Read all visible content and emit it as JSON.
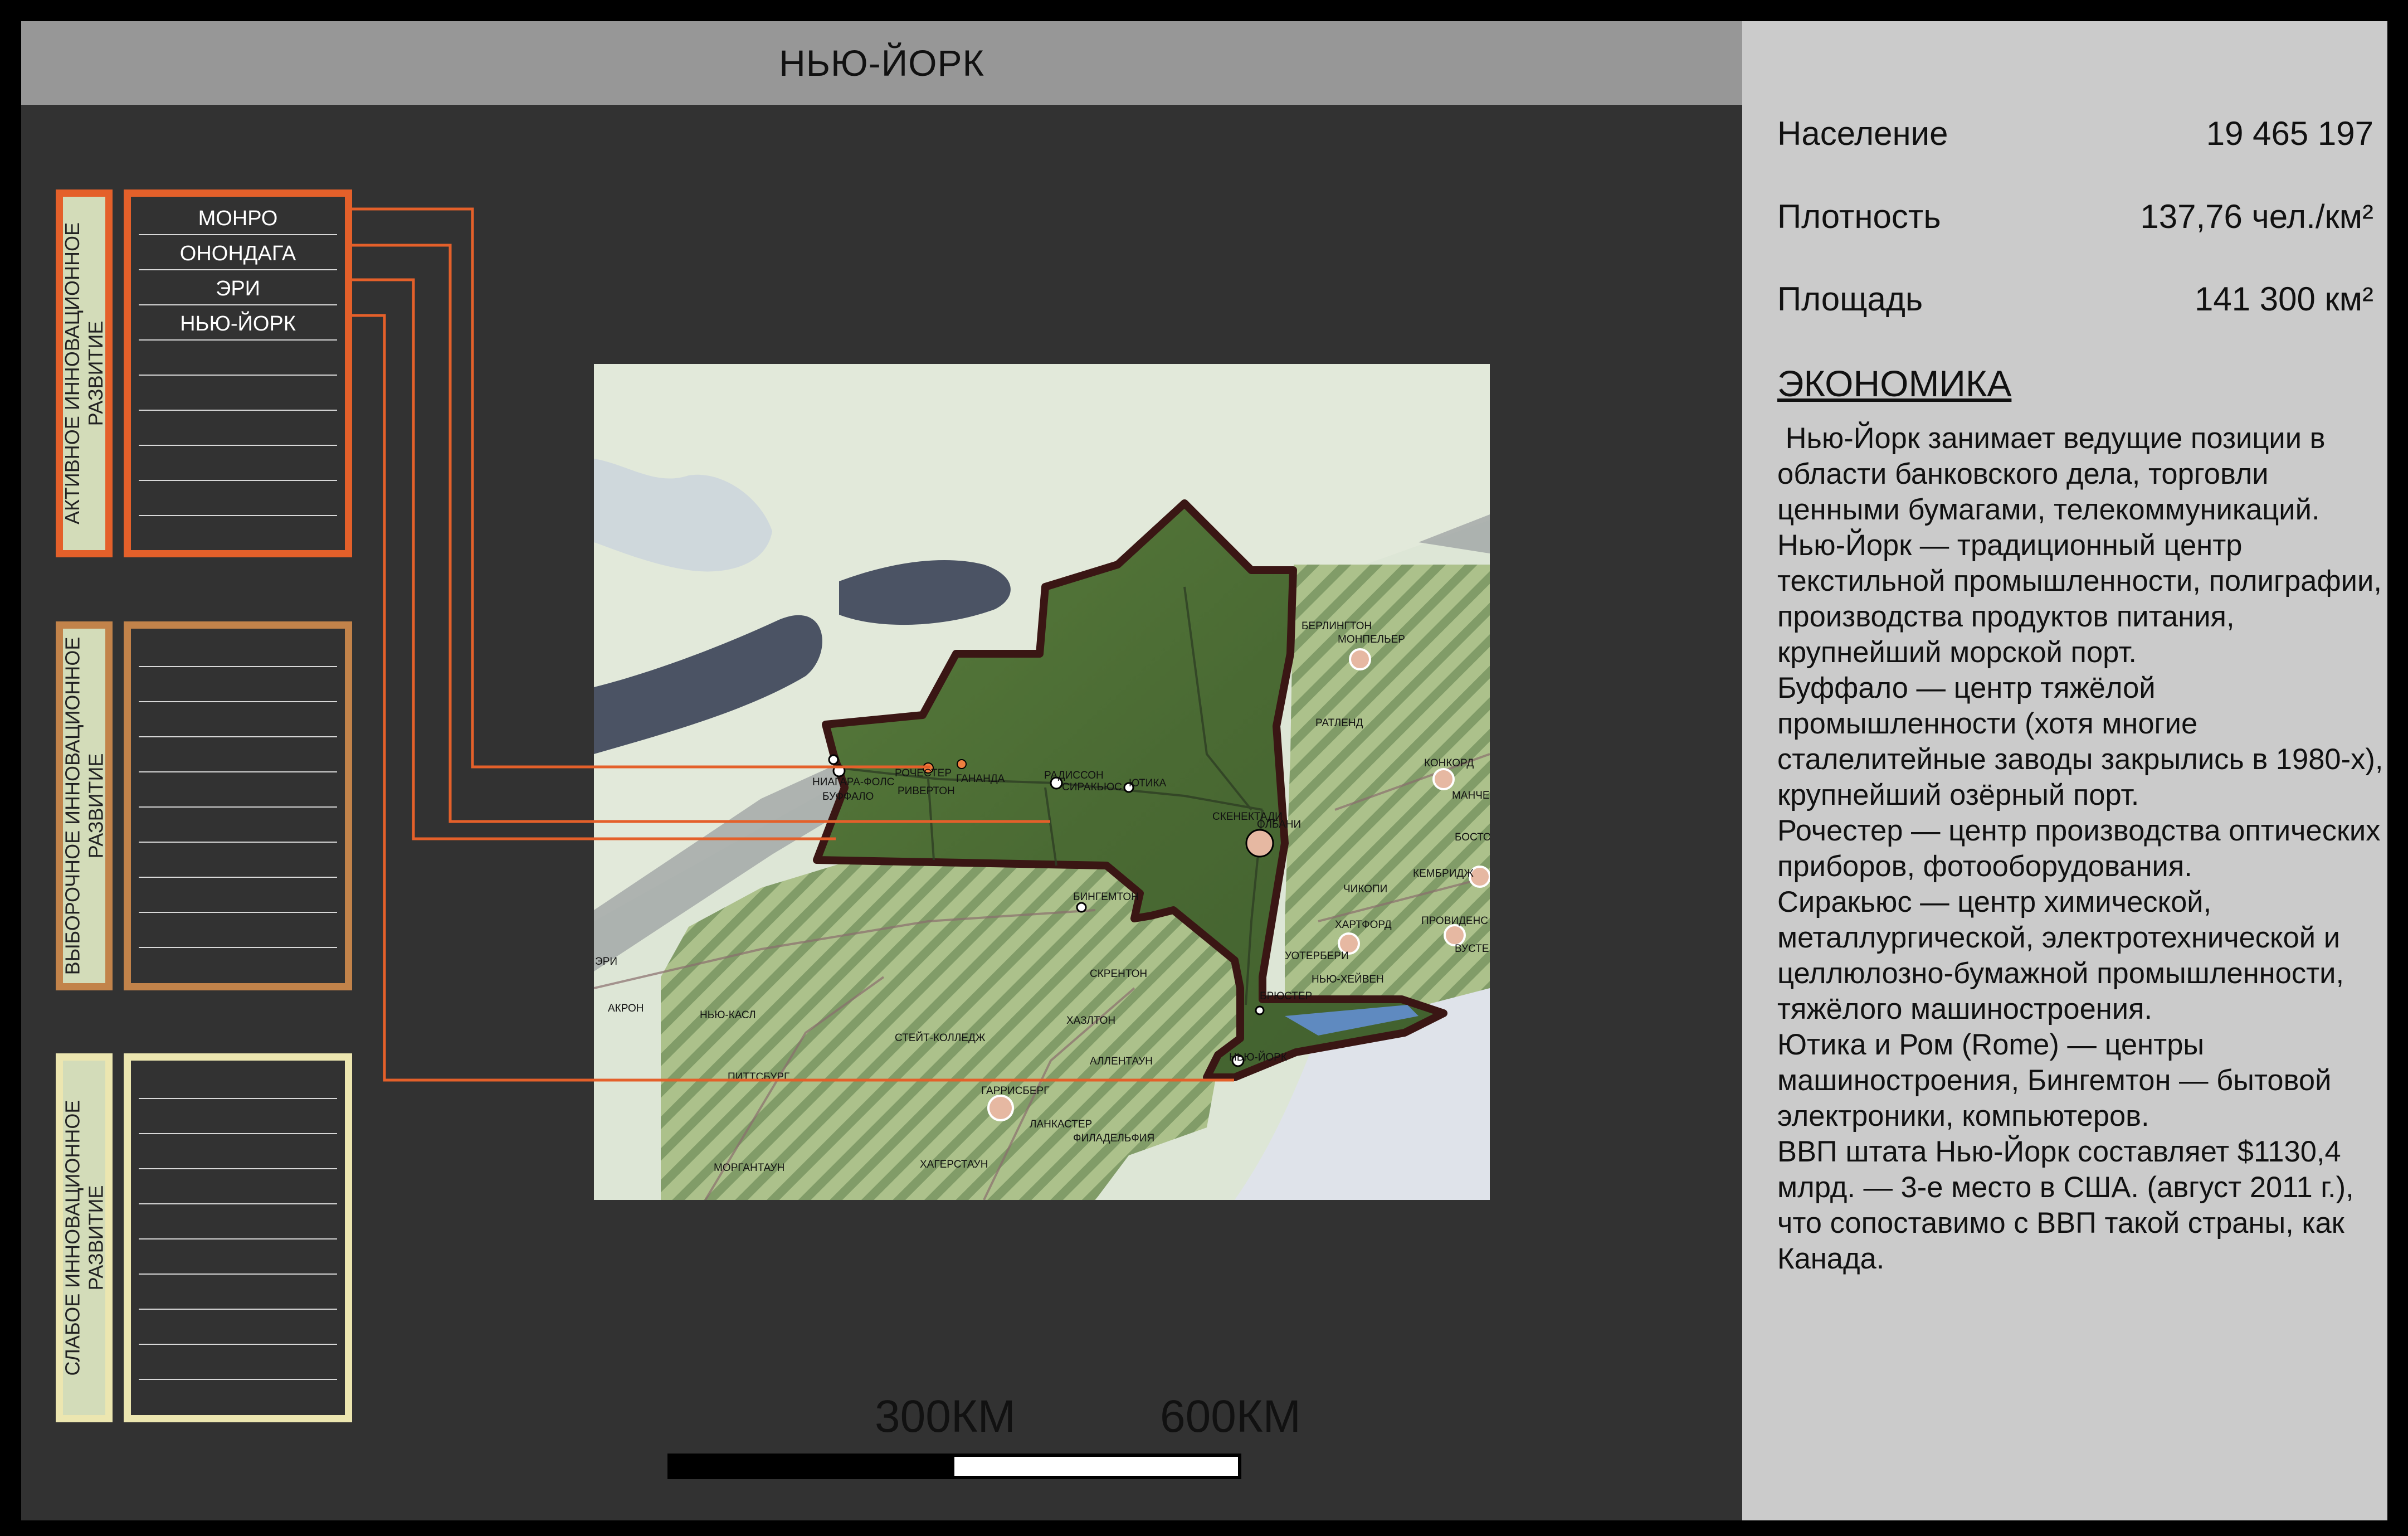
{
  "title": "НЬЮ-ЙОРК",
  "stats": [
    {
      "label": "Население",
      "value": "19 465 197"
    },
    {
      "label": "Плотность",
      "value": "137,76 чел./км²"
    },
    {
      "label": "Площадь",
      "value": "141 300 км²"
    }
  ],
  "economy": {
    "heading": "ЭКОНОМИКА",
    "paragraphs": [
      " Нью-Йорк занимает ведущие позиции в области банковского дела, торговли ценными бумагами, телекоммуникаций.",
      "Нью-Йорк — традиционный центр текстильной промышленности, полиграфии, производства продуктов питания, крупнейший морской порт.",
      "Буффало — центр тяжёлой промышленности (хотя многие сталелитейные заводы закрылись в 1980-х), крупнейший озёрный порт.",
      "Рочестер — центр производства оптических приборов, фотооборудования.",
      "Сиракьюс — центр химической, металлургической, электротехнической и целлюлозно-бумажной промышленности, тяжёлого машиностроения.",
      "Ютика и Ром (Rome) — центры машиностроения, Бингемтон — бытовой электроники, компьютеров.",
      "ВВП штата Нью-Йорк составляет $1130,4 млрд. — 3-е место в США. (август 2011 г.), что сопоставимо с ВВП такой страны, как Канада."
    ]
  },
  "categories": [
    {
      "label": "АКТИВНОЕ ИННОВАЦИОННОЕ\nРАЗВИТИЕ",
      "color": "#e4602a",
      "items": [
        "МОНРО",
        "ОНОНДАГА",
        "ЭРИ",
        "НЬЮ-ЙОРК"
      ]
    },
    {
      "label": "ВЫБОРОЧНОЕ ИННОВАЦИОННОЕ\nРАЗВИТИЕ",
      "color": "#c2834a",
      "items": []
    },
    {
      "label": "СЛАБОЕ ИННОВАЦИОННОЕ\nРАЗВИТИЕ",
      "color": "#ece6b0",
      "items": []
    }
  ],
  "map": {
    "cities_ny": [
      "НИАГАРА-ФОЛС",
      "РОЧЕСТЕР",
      "ГАНАНДА",
      "РИВЕРТОН",
      "БУФФАЛО",
      "РАДИССОН",
      "СИРАКЬЮС",
      "ЮТИКА",
      "СКЕНЕКТАДИ",
      "ОЛБАНИ",
      "БИНГЕМТОН",
      "БРЮСТЕР",
      "НЬЮ-ЙОРК"
    ],
    "cities_other": [
      "БЕРЛИНГТОН",
      "МОНПЕЛЬЕР",
      "РАТЛЕНД",
      "КОНКОРД",
      "МАНЧЕСТЕР",
      "БОСТОН",
      "КЕМБРИДЖ",
      "ЧИКОПИ",
      "ХАРТФОРД",
      "ПРОВИДЕНС",
      "ВУСТЕР",
      "УОТЕРБЕРИ",
      "НЬЮ-ХЕЙВЕН",
      "ЭРИ",
      "АКРОН",
      "НЬЮ-КАСЛ",
      "ПИТТСБУРГ",
      "СТЕЙТ-КОЛЛЕДЖ",
      "СКРЕНТОН",
      "ХАЗЛТОН",
      "АЛЛЕНТАУН",
      "ГАРРИСБЕРГ",
      "ЛАНКАСТЕР",
      "ФИЛАДЕЛЬФИЯ",
      "МОРГАНТАУН",
      "ХАГЕРСТАУН"
    ]
  },
  "scale": {
    "label_1": "300КМ",
    "label_2": "600КМ"
  },
  "colors": {
    "panel_dark": "#323232",
    "title_bar": "#979797",
    "info_panel": "#cbcbcb",
    "leader_line": "#e4602a",
    "state_fill": "#4c6b35",
    "state_border": "#3a1614"
  }
}
